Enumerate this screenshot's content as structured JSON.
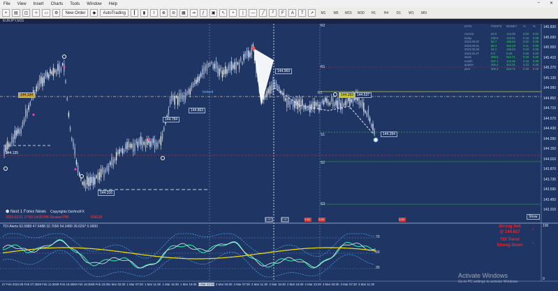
{
  "menu": [
    "File",
    "View",
    "Insert",
    "Charts",
    "Tools",
    "Window",
    "Help"
  ],
  "toolbar": {
    "new_order": "New Order",
    "auto_trading": "AutoTrading",
    "timeframes": [
      "M1",
      "M5",
      "M15",
      "M30",
      "H1",
      "H4",
      "D1",
      "W1",
      "MN"
    ]
  },
  "tab": {
    "symbol": "EURJPY,M15"
  },
  "main_chart": {
    "price_labels": [
      "145.830",
      "145.690",
      "145.550",
      "145.410",
      "145.270",
      "145.130",
      "144.990",
      "144.850",
      "144.710",
      "144.570",
      "144.430",
      "144.290",
      "144.150",
      "144.010",
      "143.870",
      "143.730",
      "143.590",
      "143.450",
      "143.310"
    ],
    "boxes": [
      "144.969",
      "144.863",
      "144.784",
      "144.537",
      "144.394",
      "144.316",
      "144.283",
      "144.194",
      "144.135"
    ],
    "levels": [
      "R2",
      "R1",
      "S1",
      "S2",
      "S3",
      "R1"
    ],
    "notes": [
      "2023.03.01 17:00 14:00 PM Session PM",
      "ENG16"
    ],
    "session": "Ireland",
    "show_btn": "Show",
    "brand": "Next 1 Forex News",
    "copyright": "Copyrights DaVinciFX",
    "bottom_marks": [
      "0.00",
      "0.00",
      "0.00",
      "0.00",
      "0.00"
    ]
  },
  "stats": {
    "headers": [
      "DATE",
      "POINTS",
      "MONEY",
      "%",
      "%"
    ],
    "rows": [
      [
        "current",
        "80.0",
        "123.05",
        "0.04",
        "0.04"
      ],
      [
        "today",
        "290.5",
        "144.01",
        "0.15",
        "0.08"
      ],
      [
        "2023.03.02",
        "52.7",
        "196.54",
        "0.02",
        "0.09"
      ],
      [
        "2023.03.01",
        "88.4",
        "154.19",
        "0.11",
        "0.09"
      ],
      [
        "2023.02.28",
        "32.1",
        "156.03",
        "0.04",
        "0.08"
      ],
      [
        "2023.02.27",
        "0.0",
        "0.00",
        "0.00",
        "0.00"
      ],
      [
        "week",
        "305.5",
        "314.71",
        "0.33",
        "0.25"
      ],
      [
        "month",
        "287.1",
        "144.46",
        "0.16",
        "0.09"
      ],
      [
        "quarter",
        "305.2",
        "344.21",
        "0.33",
        "0.25"
      ],
      [
        "year",
        "305.2",
        "344.71",
        "0.33",
        "0.25"
      ]
    ]
  },
  "indicator": {
    "title": "TDI Alerts",
    "values": "62.5880 47.6488 32.7096 54.3489 39.0297 0.0000",
    "levels": [
      "70",
      "50",
      "30"
    ],
    "price_labels": [
      "100",
      "0"
    ],
    "alerts": [
      "Strong Sell",
      "@ 144.617",
      "TDI Trend",
      "Strong Down"
    ]
  },
  "time_axis": [
    "27 Feb 2023",
    "28 Feb 07:30",
    "28 Feb 11:30",
    "28 Feb 15:30",
    "28 Feb 19:30",
    "28 Feb 23:30",
    "1 Mar 03:30",
    "1 Mar 07:30",
    "1 Mar 11:30",
    "1 Mar 15:30",
    "1 Mar 19:30",
    "1 Mar 23:30",
    "2 Mar 03:30",
    "2 Mar 07:30",
    "2 Mar 11:30",
    "2 Mar 15:30",
    "2 Mar 19:30",
    "2 Mar 23:30",
    "3 Mar 03:30",
    "3 Mar 07:30",
    "3 Mar 11:30"
  ],
  "watermark": {
    "title": "Activate Windows",
    "subtitle": "Go to PC settings to activate Windows."
  },
  "colors": {
    "bg": "#1f3563",
    "candles": "#c9d3e6",
    "rsi": "#2ee6a0",
    "signal": "#f5e300",
    "band": "#4a9ee6",
    "alert": "#ff2020"
  }
}
